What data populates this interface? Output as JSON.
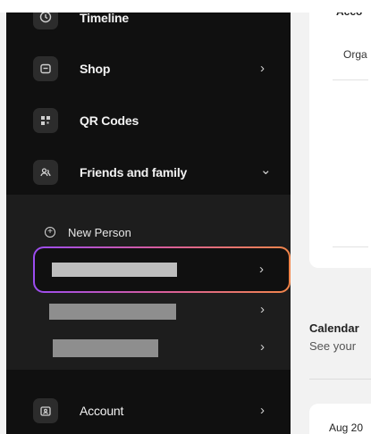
{
  "sidebar": {
    "items": [
      {
        "label": "Timeline",
        "icon": "clock-icon"
      },
      {
        "label": "Shop",
        "icon": "store-icon",
        "chevron": "›"
      },
      {
        "label": "QR Codes",
        "icon": "qr-code-icon"
      },
      {
        "label": "Friends and family",
        "icon": "people-icon",
        "chevron": "⌄"
      },
      {
        "label": "Account",
        "icon": "account-icon",
        "chevron": "›"
      }
    ],
    "friends": {
      "new_person_label": "New Person",
      "people_chevrons": [
        "›",
        "›",
        "›"
      ]
    }
  },
  "main": {
    "card_title": "Acco",
    "card_row_label": "Orga",
    "calendar_title": "Calendar",
    "calendar_subtitle": "See your",
    "calendar_date": "Aug 20"
  },
  "colors": {
    "sidebar_bg": "#101010",
    "subpanel_bg": "#1d1d1d",
    "highlight_start": "#9b4cf0",
    "highlight_end": "#f2864a"
  }
}
